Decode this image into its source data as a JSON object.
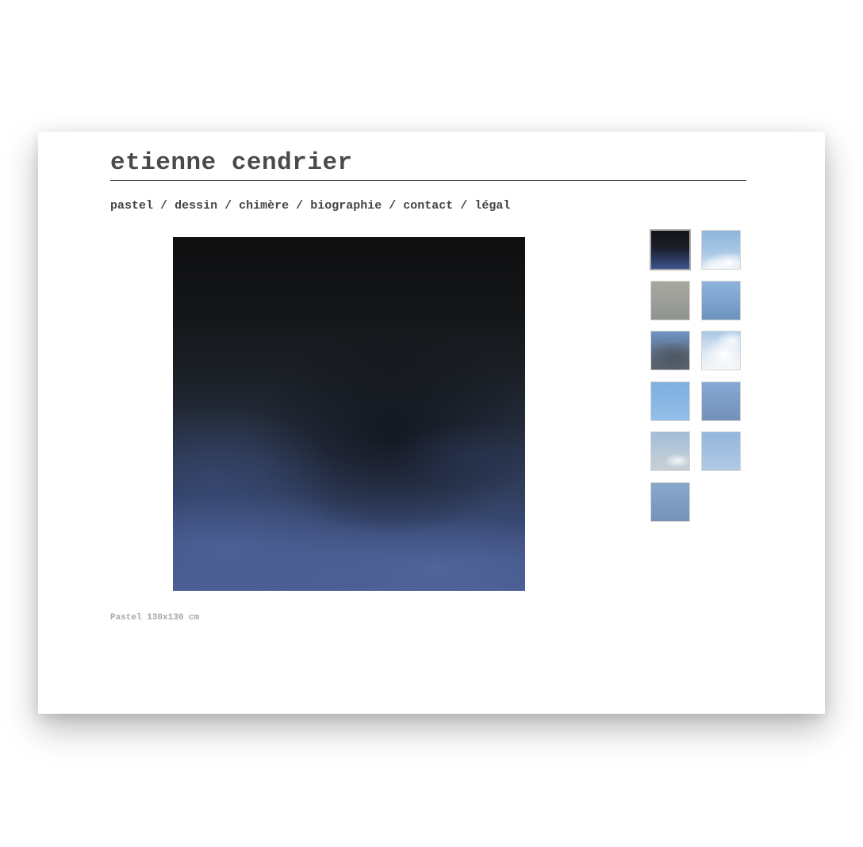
{
  "site": {
    "title": "etienne cendrier"
  },
  "nav": {
    "separator": "/",
    "items": [
      {
        "label": "pastel"
      },
      {
        "label": "dessin"
      },
      {
        "label": "chimère"
      },
      {
        "label": "biographie"
      },
      {
        "label": "contact"
      },
      {
        "label": "légal"
      }
    ]
  },
  "artwork": {
    "caption": "Pastel 130x130 cm"
  },
  "thumbnails": {
    "count": 11,
    "selected_index": 0
  }
}
